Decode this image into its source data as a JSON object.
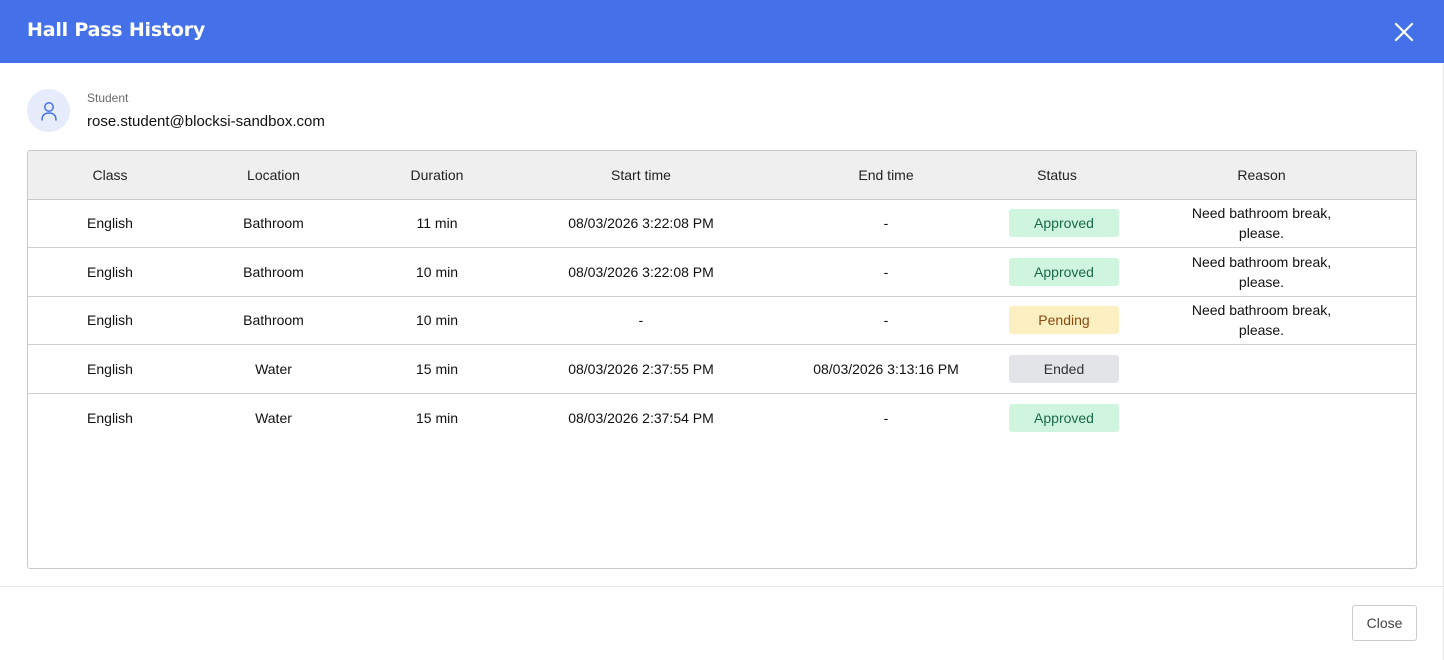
{
  "dialog": {
    "title": "Hall Pass History",
    "accent_color": "#4470ea"
  },
  "student": {
    "label": "Student",
    "email": "rose.student@blocksi-sandbox.com",
    "icon": "user-icon"
  },
  "table": {
    "columns": [
      "Class",
      "Location",
      "Duration",
      "Start time",
      "End time",
      "Status",
      "Reason"
    ],
    "rows": [
      {
        "class": "English",
        "location": "Bathroom",
        "duration": "11 min",
        "start": "08/03/2026 3:22:08 PM",
        "end": "-",
        "status": "Approved",
        "status_kind": "approved",
        "reason": "Need bathroom break, please."
      },
      {
        "class": "English",
        "location": "Bathroom",
        "duration": "10 min",
        "start": "08/03/2026 3:22:08 PM",
        "end": "-",
        "status": "Approved",
        "status_kind": "approved",
        "reason": "Need bathroom break, please."
      },
      {
        "class": "English",
        "location": "Bathroom",
        "duration": "10 min",
        "start": "-",
        "end": "-",
        "status": "Pending",
        "status_kind": "pending",
        "reason": "Need bathroom break, please."
      },
      {
        "class": "English",
        "location": "Water",
        "duration": "15 min",
        "start": "08/03/2026 2:37:55 PM",
        "end": "08/03/2026 3:13:16 PM",
        "status": "Ended",
        "status_kind": "ended",
        "reason": ""
      },
      {
        "class": "English",
        "location": "Water",
        "duration": "15 min",
        "start": "08/03/2026 2:37:54 PM",
        "end": "-",
        "status": "Approved",
        "status_kind": "approved",
        "reason": ""
      }
    ]
  },
  "status_colors": {
    "approved": "#cff5df",
    "pending": "#fcefc2",
    "ended": "#e3e4e8"
  },
  "footer": {
    "close_label": "Close"
  }
}
